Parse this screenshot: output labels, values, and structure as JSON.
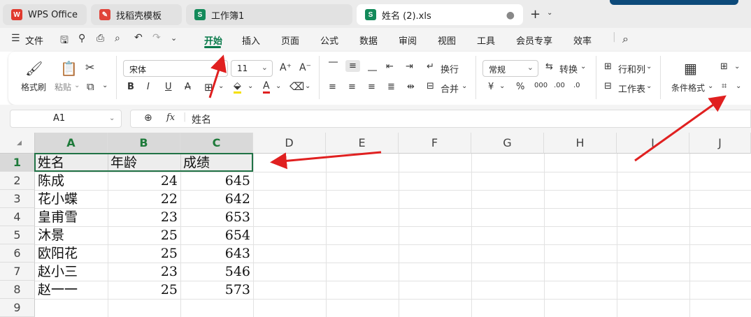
{
  "tabs": [
    {
      "label": "WPS Office",
      "color": "#e03a2f"
    },
    {
      "label": "找稻壳模板",
      "color": "#e0443a"
    },
    {
      "label": "工作簿1",
      "color": "#138a5a"
    },
    {
      "label": "姓名 (2).xls",
      "color": "#138a5a"
    }
  ],
  "newtab": {
    "plus": "+",
    "more": "⌄"
  },
  "menu": {
    "file": "文件",
    "items": [
      "开始",
      "插入",
      "页面",
      "公式",
      "数据",
      "审阅",
      "视图",
      "工具",
      "会员专享",
      "效率"
    ],
    "active": "开始"
  },
  "ribbon": {
    "format_painter": "格式刷",
    "paste": "粘贴",
    "font_name": "宋体",
    "font_size": "11",
    "wrap": "换行",
    "merge": "合并",
    "number_format": "常规",
    "convert": "转换",
    "rows_cols": "行和列",
    "worksheet": "工作表",
    "cond_format": "条件格式"
  },
  "formula": {
    "cell_ref": "A1",
    "fx": "fx",
    "content": "姓名"
  },
  "sheet": {
    "columns": [
      "A",
      "B",
      "C",
      "D",
      "E",
      "F",
      "G",
      "H",
      "I",
      "J"
    ],
    "rows": [
      "1",
      "2",
      "3",
      "4",
      "5",
      "6",
      "7",
      "8",
      "9"
    ],
    "header": [
      "姓名",
      "年龄",
      "成绩"
    ],
    "data": [
      [
        "陈成",
        "24",
        "645"
      ],
      [
        "花小蝶",
        "22",
        "642"
      ],
      [
        "皇甫雪",
        "23",
        "653"
      ],
      [
        "沐景",
        "25",
        "654"
      ],
      [
        "欧阳花",
        "25",
        "643"
      ],
      [
        "赵小三",
        "23",
        "546"
      ],
      [
        "赵一一",
        "25",
        "573"
      ]
    ]
  },
  "colors": {
    "accent": "#0a7a4b",
    "selection": "#217346",
    "arrow": "#e02020"
  }
}
